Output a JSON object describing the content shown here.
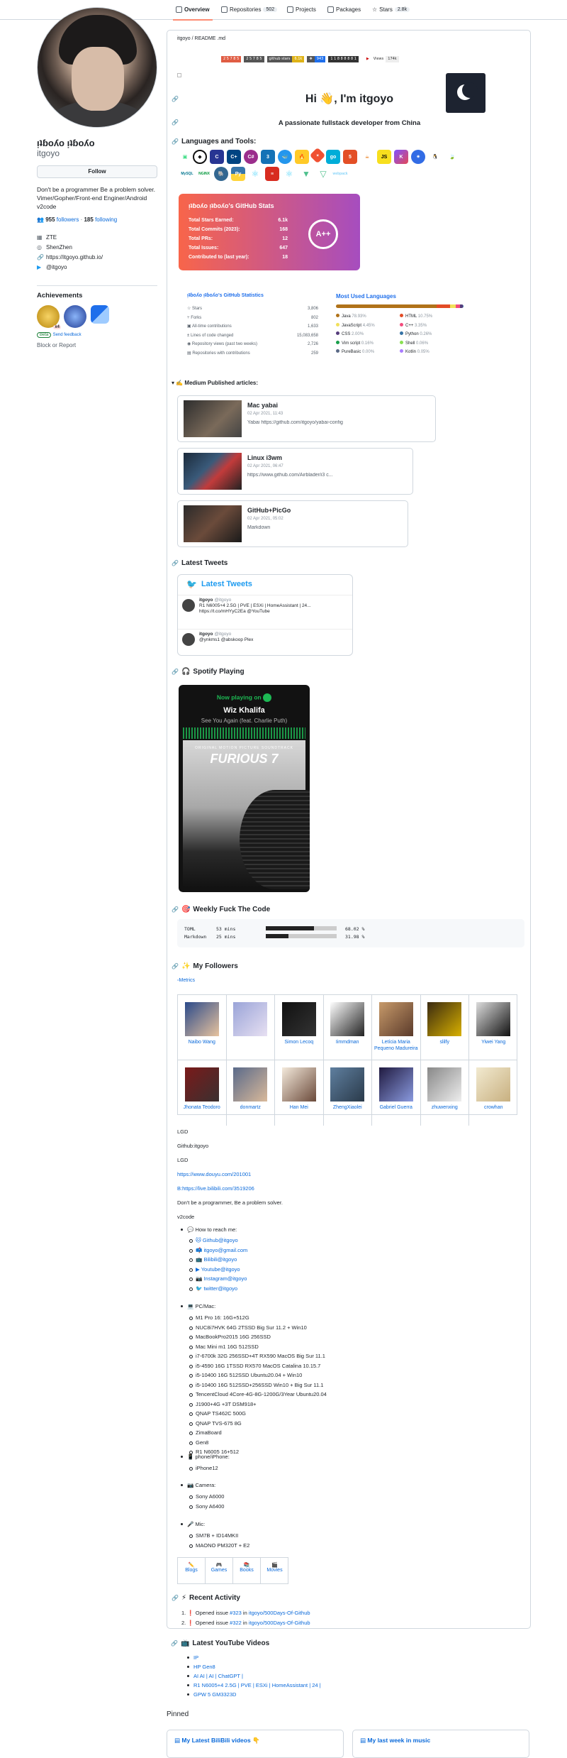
{
  "nav": {
    "overview": "Overview",
    "repositories": "Repositories",
    "repo_count": "502",
    "projects": "Projects",
    "packages": "Packages",
    "stars": "Stars",
    "stars_count": "2.8k"
  },
  "profile": {
    "name": "ᴉʇɓoʎo ᴉʇɓoʎo",
    "login": "itgoyo",
    "follow": "Follow",
    "bio": "Don't be a programmer Be a problem solver. Vimer/Gopher/Front-end Enginer/Android  v2code",
    "followers": "955",
    "followers_label": "followers",
    "following": "185",
    "following_label": "following",
    "company": "ZTE",
    "location": "ShenZhen",
    "website": "https://itgoyo.github.io/",
    "twitter": "@itgoyo"
  },
  "achievements": {
    "title": "Achievements",
    "beta": "Beta",
    "feedback": "Send feedback",
    "x_label": "x4",
    "block": "Block or Report"
  },
  "readme": {
    "path": "itgoyo / README .md",
    "hi": "Hi 👋, I'm itgoyo",
    "subtitle": "A passionate fullstack developer from China",
    "languages_title": "Languages and Tools:",
    "views_label": "Views",
    "views_count": "174k"
  },
  "badges": [
    "2 5 7 8 5",
    "github stars",
    "6.1k",
    "943",
    "1 1 8 8 8 8 8 1"
  ],
  "tech_icons": [
    "android",
    "c",
    "cpp",
    "csharp",
    "css3",
    "docker",
    "firebase",
    "git",
    "go",
    "html5",
    "java",
    "js",
    "kotlin",
    "k8s",
    "linux",
    "mongo",
    "mysql",
    "nginx",
    "postgres",
    "python",
    "react",
    "redis",
    "vue",
    "vuejs",
    "webpack"
  ],
  "gh_stats": {
    "title": "ᴉʇɓoʎo ᴉʇɓoʎo's GitHub Stats",
    "rows": [
      {
        "label": "Total Stars Earned:",
        "value": "6.1k"
      },
      {
        "label": "Total Commits (2023):",
        "value": "168"
      },
      {
        "label": "Total PRs:",
        "value": "12"
      },
      {
        "label": "Total Issues:",
        "value": "647"
      },
      {
        "label": "Contributed to (last year):",
        "value": "18"
      }
    ],
    "grade": "A++"
  },
  "statistics": {
    "title": "ᴉʇɓoʎo ᴉʇɓoʎo's GitHub Statistics",
    "rows": [
      {
        "label": "Stars",
        "value": "3,806"
      },
      {
        "label": "Forks",
        "value": "802"
      },
      {
        "label": "All-time contributions",
        "value": "1,633"
      },
      {
        "label": "Lines of code changed",
        "value": "15,083,658"
      },
      {
        "label": "Repository views (past two weeks)",
        "value": "2,726"
      },
      {
        "label": "Repositories with contributions",
        "value": "259"
      }
    ]
  },
  "languages": {
    "title": "Most Used Languages",
    "items": [
      {
        "name": "Java",
        "pct": "78.93%",
        "color": "#b07219"
      },
      {
        "name": "HTML",
        "pct": "10.75%",
        "color": "#e34c26"
      },
      {
        "name": "JavaScript",
        "pct": "4.45%",
        "color": "#f1e05a"
      },
      {
        "name": "C++",
        "pct": "3.35%",
        "color": "#f34b7d"
      },
      {
        "name": "CSS",
        "pct": "2.00%",
        "color": "#563d7c"
      },
      {
        "name": "Python",
        "pct": "0.26%",
        "color": "#3572A5"
      },
      {
        "name": "Vim script",
        "pct": "0.16%",
        "color": "#199f4b"
      },
      {
        "name": "Shell",
        "pct": "0.06%",
        "color": "#89e051"
      },
      {
        "name": "PureBasic",
        "pct": "0.00%",
        "color": "#5a6986"
      },
      {
        "name": "Kotlin",
        "pct": "0.05%",
        "color": "#A97BFF"
      }
    ]
  },
  "medium": {
    "title": "Medium Published articles:",
    "articles": [
      {
        "title": "Mac yabai",
        "date": "02 Apr 2021, 11:43",
        "text": " Yabai https://github.com/itgoyo/yabai-config"
      },
      {
        "title": "Linux i3wm",
        "date": "02 Apr 2021, 06:47",
        "text": " https://www.github.com/Airblader/i3 c..."
      },
      {
        "title": "GitHub+PicGo",
        "date": "02 Apr 2021, 05:02",
        "text": " Markdown "
      }
    ]
  },
  "tweets": {
    "title": "Latest Tweets",
    "card_title": "Latest Tweets",
    "items": [
      {
        "user": "itgoyo",
        "handle": "@itgoyo",
        "text": "R1 N6005+4 2.5G | PVE | ESXi | HomeAssistant | 24... https://t.co/mHYyC2Ea @YouTube"
      },
      {
        "user": "itgoyo",
        "handle": "@itgoyo",
        "text": "@ynkms1 @abskoop Plex"
      }
    ]
  },
  "spotify": {
    "title": "Spotify Playing",
    "now": "Now playing on",
    "artist": "Wiz Khalifa",
    "song": "See You Again (feat. Charlie Puth)",
    "album_top": "ORIGINAL MOTION PICTURE SOUNDTRACK",
    "album": "FURIOUS 7"
  },
  "wakatime": {
    "title": "Weekly Fuck The Code",
    "rows": [
      {
        "lang": "TOML",
        "time": "53 mins",
        "pct": "68.02 %"
      },
      {
        "lang": "Markdown",
        "time": "25 mins",
        "pct": "31.98 %"
      }
    ]
  },
  "followers": {
    "title": "My Followers",
    "metrics": "Metrics",
    "row1": [
      "Naibo Wang",
      "",
      "Simon Lecoq",
      "Iimmdman",
      "Letícia Maria Pequeno Madureira",
      "slilfy",
      "Yiwei Yang"
    ],
    "row2": [
      "Jhonata Teodoro",
      "donmartz",
      "Han Mei",
      "ZhengXiaolei",
      "Gabriel Guerra",
      "zhuwenxing",
      "crowhan"
    ]
  },
  "about": {
    "lines": [
      "LGD",
      "Github:itgoyo",
      "LGD",
      "https://www.douyu.com/201001",
      "B:https://live.bilibili.com/3519206",
      "Don't be a programmer, Be a problem solver.",
      "v2code"
    ],
    "reach": "How to reach me:",
    "contacts": [
      "Github@itgoyo",
      "itgoyo@gmail.com",
      "Bilibili@itgoyo",
      "Youtube@itgoyo",
      "Instagram@itgoyo",
      "twitter@itgoyo"
    ],
    "pc": "PC/Mac:",
    "pcs": [
      "M1 Pro 16: 16G+512G",
      "NUC8i7HVK 64G 2TSSD Big Sur 11.2 + Win10",
      "MacBookPro2015 16G 256SSD",
      "Mac Mini m1 16G 512SSD",
      "i7-6700k 32G 256SSD+4T RX590 MacOS Big Sur 11.1",
      "i5-4590 16G 1TSSD RX570 MacOS Catalina 10.15.7",
      "i5-10400 16G 512SSD Ubuntu20.04 + Win10",
      "i5-10400 16G 512SSD+256SSD Win10 + Big Sur 11.1",
      "TencentCloud 4Core-4G-8G-1200G/3Year Ubuntu20.04",
      "J1900+4G +3T DSM918+",
      "QNAP TS462C 500G",
      "QNAP TVS-675 8G",
      "ZimaBoard",
      "Gen8",
      "R1 N6005 16+512"
    ],
    "phone": "phone/iPhone:",
    "phones": [
      "iPhone12"
    ],
    "camera": "Camera:",
    "cameras": [
      "Sony A6000",
      "Sony A6400"
    ],
    "mic": "Mic:",
    "mics": [
      "SM7B + ID14MKII",
      "MAONO PM320T + E2"
    ],
    "links": [
      "Blogs",
      "Games",
      "Books",
      "Movies"
    ]
  },
  "activity": {
    "title": "Recent Activity",
    "items": [
      {
        "n": "1.",
        "pre": "Opened issue ",
        "issue": "#323",
        "mid": " in ",
        "repo": "itgoyo/500Days-Of-Github"
      },
      {
        "n": "2.",
        "pre": "Opened issue ",
        "issue": "#322",
        "mid": " in ",
        "repo": "itgoyo/500Days-Of-Github"
      }
    ]
  },
  "youtube": {
    "title": "Latest YouTube Videos",
    "items": [
      "IP",
      "HP Gen8",
      "AI AI | AI | ChatGPT |",
      "R1 N6005+4 2.5G | PVE | ESXi | HomeAssistant | 24 |",
      "GPW 5 GM3323D"
    ]
  },
  "pinned": {
    "title": "Pinned",
    "items": [
      "My Latest BiliBili videos 👇",
      "My last week in music"
    ]
  }
}
